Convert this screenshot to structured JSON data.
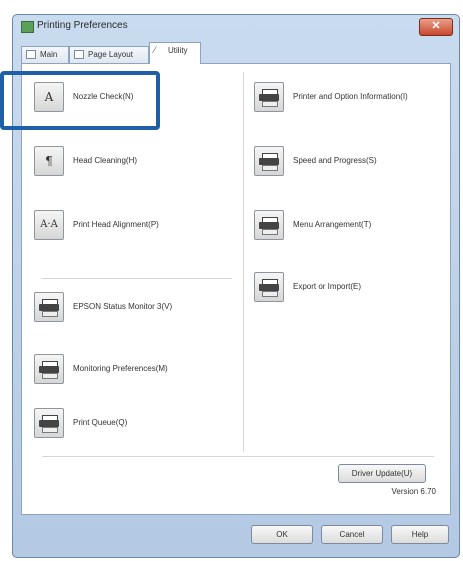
{
  "window": {
    "title": "Printing Preferences",
    "close_label": "✕"
  },
  "tabs": [
    {
      "label": "Main"
    },
    {
      "label": "Page Layout"
    },
    {
      "label": "Utility"
    }
  ],
  "utilities_left": [
    {
      "label": "Nozzle Check(N)",
      "icon": "nozzle-check-icon"
    },
    {
      "label": "Head Cleaning(H)",
      "icon": "head-cleaning-icon"
    },
    {
      "label": "Print Head Alignment(P)",
      "icon": "alignment-icon"
    },
    {
      "label": "EPSON Status Monitor 3(V)",
      "icon": "printer-icon"
    },
    {
      "label": "Monitoring Preferences(M)",
      "icon": "printer-icon"
    },
    {
      "label": "Print Queue(Q)",
      "icon": "printer-icon"
    }
  ],
  "utilities_right": [
    {
      "label": "Printer and Option Information(I)",
      "icon": "printer-icon"
    },
    {
      "label": "Speed and Progress(S)",
      "icon": "printer-icon"
    },
    {
      "label": "Menu Arrangement(T)",
      "icon": "printer-icon"
    },
    {
      "label": "Export or Import(E)",
      "icon": "printer-icon"
    }
  ],
  "glyphs": {
    "nozzle": "A",
    "cleaning": "¶",
    "alignment": "A·A"
  },
  "driver_update_label": "Driver Update(U)",
  "version": "Version 6.70",
  "footer": {
    "ok_label": "OK",
    "cancel_label": "Cancel",
    "help_label": "Help"
  },
  "colors": {
    "highlight": "#1f5ea8",
    "title_bar": "#c9dbef"
  }
}
